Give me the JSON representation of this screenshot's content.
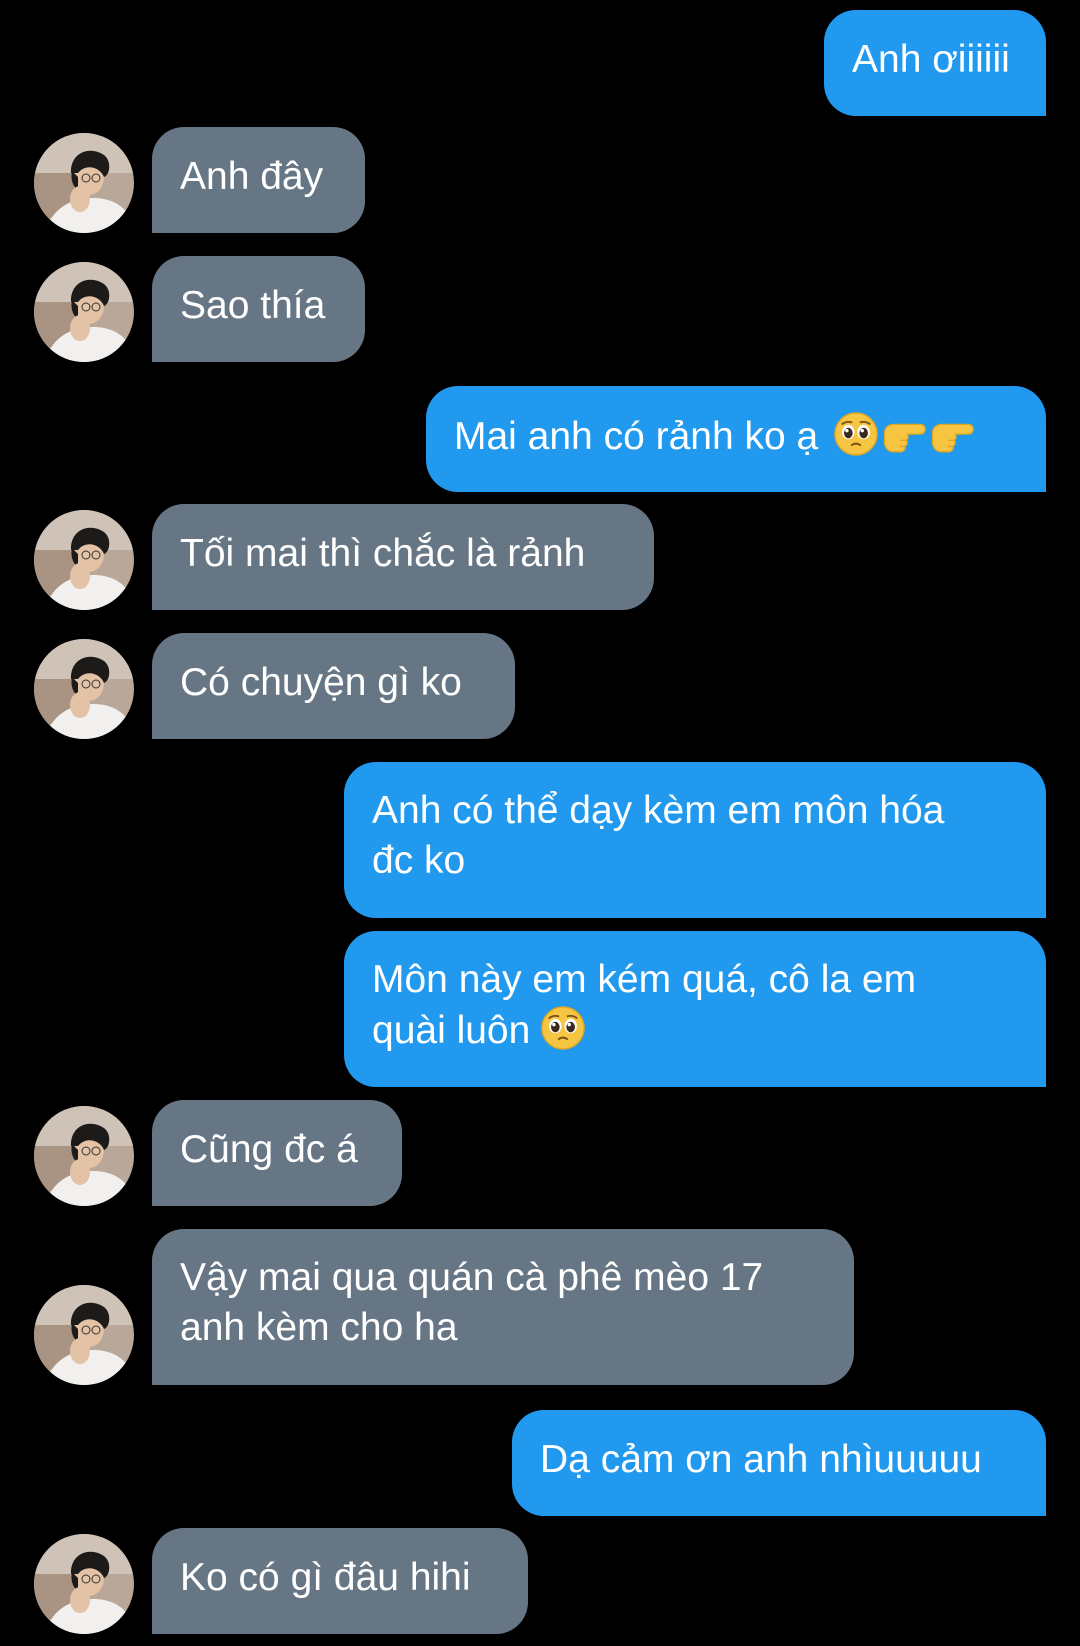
{
  "colors": {
    "background": "#000000",
    "outgoing_bubble": "#2099ef",
    "incoming_bubble": "#677684",
    "text": "#ffffff"
  },
  "messages": [
    {
      "sender": "me",
      "text": "Anh ơiiiiii"
    },
    {
      "sender": "other",
      "text": "Anh đây"
    },
    {
      "sender": "other",
      "text": "Sao thía"
    },
    {
      "sender": "me",
      "text": "Mai anh có rảnh ko ạ",
      "emoji": [
        "pleading-face",
        "pointing-right",
        "pointing-right"
      ]
    },
    {
      "sender": "other",
      "text": "Tối mai thì chắc là rảnh"
    },
    {
      "sender": "other",
      "text": "Có chuyện gì ko"
    },
    {
      "sender": "me",
      "line1": "Anh có thể dạy kèm em môn hóa",
      "line2": "đc ko"
    },
    {
      "sender": "me",
      "line1": "Môn này em kém quá, cô la em",
      "line2": "quài luôn",
      "emoji": [
        "pleading-face"
      ]
    },
    {
      "sender": "other",
      "text": "Cũng đc á"
    },
    {
      "sender": "other",
      "line1": "Vậy mai qua quán cà phê mèo 17",
      "line2": "anh kèm cho ha"
    },
    {
      "sender": "me",
      "text": "Dạ cảm ơn anh nhìuuuuu"
    },
    {
      "sender": "other",
      "text": "Ko có gì đâu hihi"
    }
  ]
}
